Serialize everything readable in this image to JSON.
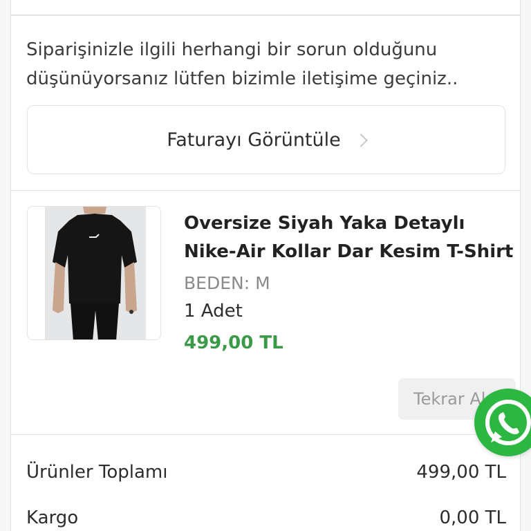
{
  "notice": "Siparişinizle ilgili herhangi bir sorun olduğunu düşünüyorsanız lütfen bizimle iletişime geçiniz..",
  "invoice_button": {
    "label": "Faturayı Görüntüle"
  },
  "product": {
    "name": "Oversize Siyah Yaka Detaylı Nike-Air Kollar Dar Kesim T-Shirt",
    "size": "BEDEN: M",
    "quantity": "1 Adet",
    "price": "499,00 TL",
    "reorder_label": "Tekrar Al"
  },
  "summary": [
    {
      "label": "Ürünler Toplamı",
      "value": "499,00 TL"
    },
    {
      "label": "Kargo",
      "value": "0,00 TL"
    }
  ],
  "colors": {
    "price_green": "#3a9a48",
    "whatsapp_green": "#2bb741"
  },
  "icons": [
    "chevron-right-icon",
    "whatsapp-icon"
  ]
}
